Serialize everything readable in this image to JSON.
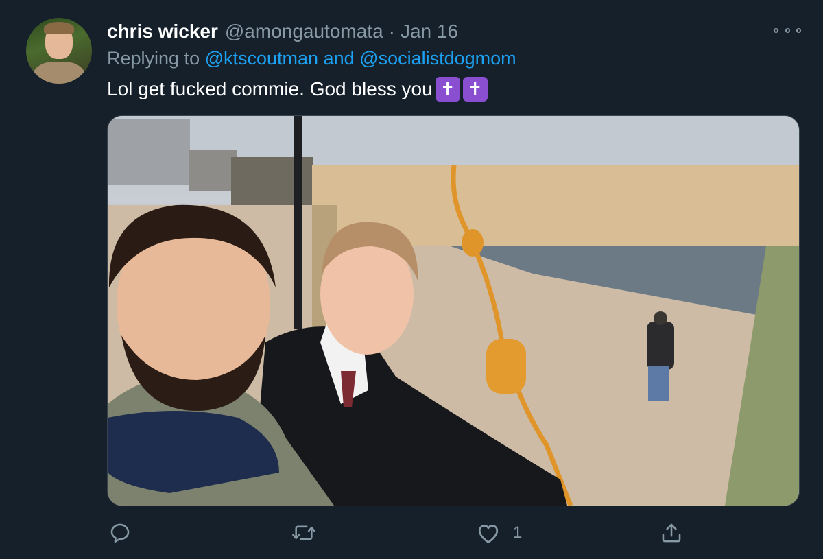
{
  "tweet": {
    "author_name": "chris wicker",
    "author_handle": "@amongautomata",
    "separator": "·",
    "date": "Jan 16",
    "replying_prefix": "Replying to",
    "reply_to_1": "@ktscoutman",
    "reply_joiner": "and",
    "reply_to_2": "@socialistdogmom",
    "text": "Lol get fucked commie. God bless you",
    "emoji_1": "✝",
    "emoji_2": "✝"
  },
  "actions": {
    "reply_icon": "reply-icon",
    "retweet_icon": "retweet-icon",
    "like_icon": "heart-icon",
    "like_count": "1",
    "share_icon": "share-icon"
  },
  "colors": {
    "background": "#15202b",
    "secondary_text": "#8899a6",
    "link": "#1da1f2",
    "emoji_bg": "#8a4fd1"
  }
}
